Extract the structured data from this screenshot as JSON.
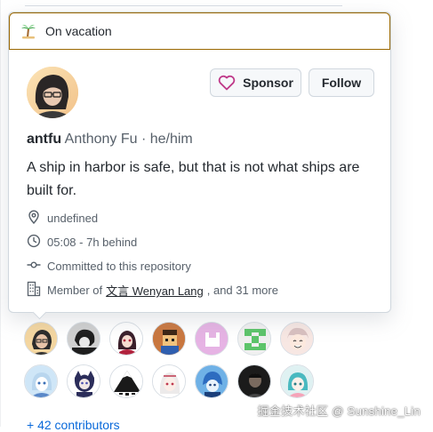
{
  "status": {
    "emoji_icon": "palm-tree-icon",
    "text": "On vacation",
    "border_color": "#9a6700"
  },
  "profile": {
    "login": "antfu",
    "name": "Anthony Fu · he/him",
    "bio": "A ship in harbor is safe, but that is not what ships are built for.",
    "location": "undefined",
    "local_time": "05:08 - 7h behind",
    "commit_note": "Committed to this repository",
    "member_prefix": "Member of",
    "org_name": "文言 Wenyan Lang",
    "member_suffix": ", and 31 more"
  },
  "buttons": {
    "sponsor_label": "Sponsor",
    "follow_label": "Follow",
    "heart_color": "#bf3989"
  },
  "contributors": {
    "row1": [
      "antfu",
      "contributor-2",
      "contributor-3",
      "contributor-4",
      "contributor-5",
      "contributor-6",
      "contributor-7"
    ],
    "row2": [
      "contributor-8",
      "contributor-9",
      "contributor-10",
      "contributor-11",
      "contributor-12",
      "contributor-13",
      "contributor-14"
    ],
    "more_label": "+ 42 contributors"
  },
  "watermark": "掘金技术社区 @ Sunshine_Lin"
}
